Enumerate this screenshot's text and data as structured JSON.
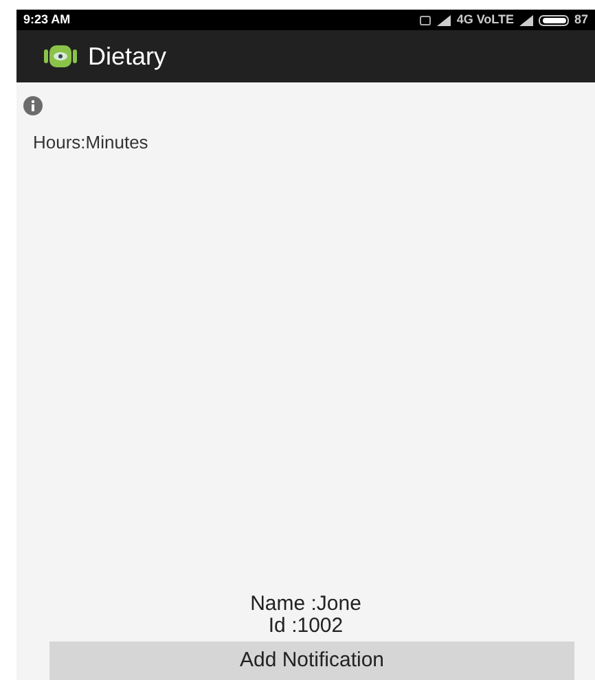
{
  "status_bar": {
    "time": "9:23 AM",
    "network": "4G VoLTE",
    "battery": "87"
  },
  "app_bar": {
    "title": "Dietary"
  },
  "content": {
    "time_label": "Hours:Minutes",
    "name": "Name :Jone",
    "id": "Id :1002"
  },
  "buttons": [
    "Add Notification"
  ]
}
